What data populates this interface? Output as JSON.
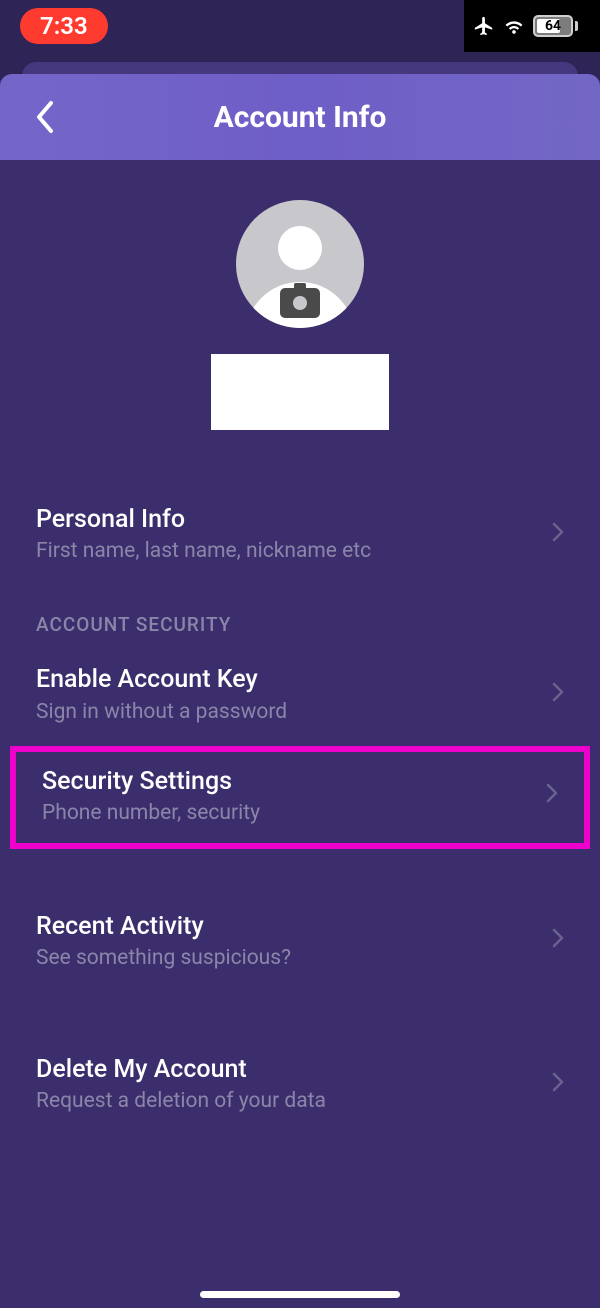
{
  "status": {
    "time": "7:33",
    "battery": "64"
  },
  "header": {
    "title": "Account Info"
  },
  "sections": {
    "personal_info": {
      "title": "Personal Info",
      "subtitle": "First name, last name, nickname etc"
    },
    "account_security_header": "ACCOUNT SECURITY",
    "enable_key": {
      "title": "Enable Account Key",
      "subtitle": "Sign in without a password"
    },
    "security_settings": {
      "title": "Security Settings",
      "subtitle": "Phone number, security"
    },
    "recent_activity": {
      "title": "Recent Activity",
      "subtitle": "See something suspicious?"
    },
    "delete_account": {
      "title": "Delete My Account",
      "subtitle": "Request a deletion of your data"
    }
  }
}
